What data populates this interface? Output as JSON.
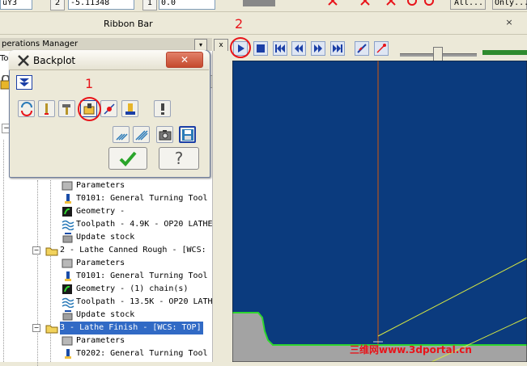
{
  "top_toolbar": {
    "field_a": "uY3",
    "field_b": "2",
    "field_c": "-5.11348",
    "field_d": "1",
    "field_e": "0.0",
    "field_f": "All...",
    "field_g": "Only..."
  },
  "ribbon": {
    "label": "Ribbon Bar",
    "close": "×"
  },
  "annotations": {
    "one": "1",
    "two": "2",
    "color": "#e8141a"
  },
  "ops_manager": {
    "title": "perations Manager",
    "drop_glyph": "▾",
    "pin_glyph": "x",
    "side_label": "Toc"
  },
  "tree": {
    "items": [
      {
        "label": "Parameters",
        "icon": "parameters-icon"
      },
      {
        "label": "T0101: General Turning Tool",
        "icon": "tool-icon"
      },
      {
        "label": "Geometry -",
        "icon": "geometry-icon"
      },
      {
        "label": "Toolpath - 4.9K - OP20 LATHE",
        "icon": "toolpath-icon"
      },
      {
        "label": "Update stock",
        "icon": "stock-icon"
      },
      {
        "label": "2 - Lathe Canned Rough - [WCS:",
        "icon": "folder-icon",
        "op": true
      },
      {
        "label": "Parameters",
        "icon": "parameters-icon"
      },
      {
        "label": "T0101: General Turning Tool",
        "icon": "tool-icon"
      },
      {
        "label": "Geometry - (1) chain(s)",
        "icon": "geometry-icon"
      },
      {
        "label": "Toolpath - 13.5K - OP20 LATH",
        "icon": "toolpath-icon"
      },
      {
        "label": "Update stock",
        "icon": "stock-icon"
      },
      {
        "label": "3 - Lathe Finish - [WCS: TOP]",
        "icon": "folder-icon",
        "op": true,
        "selected": true
      },
      {
        "label": "Parameters",
        "icon": "parameters-icon"
      },
      {
        "label": "T0202: General Turning Tool",
        "icon": "tool-icon"
      }
    ]
  },
  "backplot": {
    "title": "Backplot",
    "ok_icon": "check-icon",
    "help_label": "?"
  },
  "watermark": "三维网www.3dportal.cn",
  "colors": {
    "viewport_bg": "#0b3b7e",
    "axis_line": "#b3541e",
    "toolpath_line": "#d7e842",
    "stock_fill": "#a3a3a3",
    "stock_outline": "#2fd62f",
    "selection": "#316ac5"
  }
}
